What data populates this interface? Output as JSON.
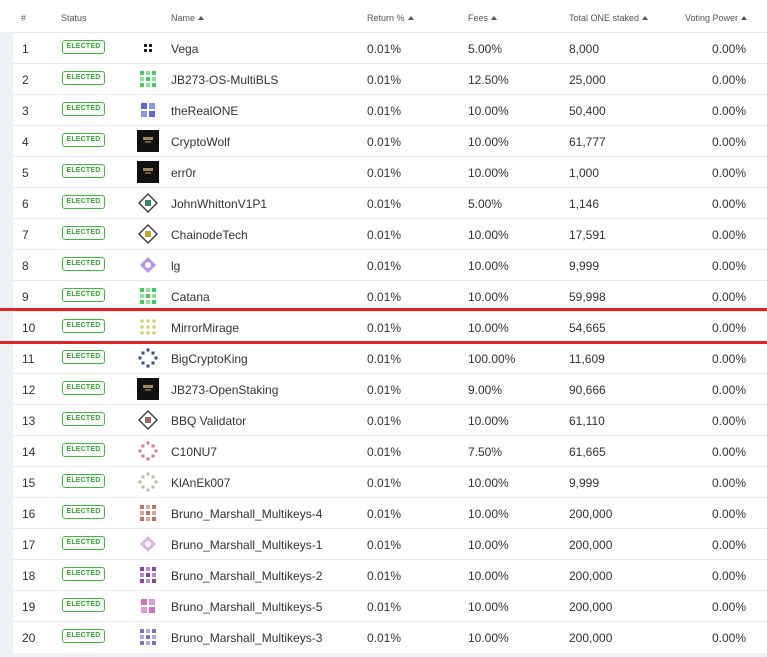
{
  "columns": {
    "rank": "#",
    "status": "Status",
    "name": "Name",
    "return": "Return %",
    "fees": "Fees",
    "staked": "Total ONE staked",
    "voting": "Voting Power"
  },
  "rows": [
    {
      "rank": "1",
      "status": "ELECTED",
      "name": "Vega",
      "return": "0.01%",
      "fees": "5.00%",
      "staked": "8,000",
      "voting": "0.00%",
      "avatar": {
        "bg": "#ffffff",
        "fg": "#222222",
        "style": "grid4"
      }
    },
    {
      "rank": "2",
      "status": "ELECTED",
      "name": "JB273-OS-MultiBLS",
      "return": "0.01%",
      "fees": "12.50%",
      "staked": "25,000",
      "voting": "0.00%",
      "avatar": {
        "bg": "#ffffff",
        "fg": "#3ccf5a",
        "style": "grid9"
      }
    },
    {
      "rank": "3",
      "status": "ELECTED",
      "name": "theRealONE",
      "return": "0.01%",
      "fees": "10.00%",
      "staked": "50,400",
      "voting": "0.00%",
      "avatar": {
        "bg": "#ffffff",
        "fg": "#5a6ad8",
        "style": "quad"
      }
    },
    {
      "rank": "4",
      "status": "ELECTED",
      "name": "CryptoWolf",
      "return": "0.01%",
      "fees": "10.00%",
      "staked": "61,777",
      "voting": "0.00%",
      "avatar": {
        "bg": "#111111",
        "fg": "#c8a868",
        "style": "photo"
      }
    },
    {
      "rank": "5",
      "status": "ELECTED",
      "name": "err0r",
      "return": "0.01%",
      "fees": "10.00%",
      "staked": "1,000",
      "voting": "0.00%",
      "avatar": {
        "bg": "#111111",
        "fg": "#c8a868",
        "style": "photo"
      }
    },
    {
      "rank": "6",
      "status": "ELECTED",
      "name": "JohnWhittonV1P1",
      "return": "0.01%",
      "fees": "5.00%",
      "staked": "1,146",
      "voting": "0.00%",
      "avatar": {
        "bg": "#ffffff",
        "fg": "#2c8c6c",
        "style": "diamond"
      }
    },
    {
      "rank": "7",
      "status": "ELECTED",
      "name": "ChainodeTech",
      "return": "0.01%",
      "fees": "10.00%",
      "staked": "17,591",
      "voting": "0.00%",
      "avatar": {
        "bg": "#ffffff",
        "fg": "#c8a030",
        "style": "diamond"
      }
    },
    {
      "rank": "8",
      "status": "ELECTED",
      "name": "lg",
      "return": "0.01%",
      "fees": "10.00%",
      "staked": "9,999",
      "voting": "0.00%",
      "avatar": {
        "bg": "#ffffff",
        "fg": "#a878d8",
        "style": "burst"
      }
    },
    {
      "rank": "9",
      "status": "ELECTED",
      "name": "Catana",
      "return": "0.01%",
      "fees": "10.00%",
      "staked": "59,998",
      "voting": "0.00%",
      "avatar": {
        "bg": "#ffffff",
        "fg": "#3ccf5a",
        "style": "grid9"
      }
    },
    {
      "rank": "10",
      "status": "ELECTED",
      "name": "MirrorMirage",
      "return": "0.01%",
      "fees": "10.00%",
      "staked": "54,665",
      "voting": "0.00%",
      "avatar": {
        "bg": "#ffffff",
        "fg": "#cfd36a",
        "style": "dots"
      }
    },
    {
      "rank": "11",
      "status": "ELECTED",
      "name": "BigCryptoKing",
      "return": "0.01%",
      "fees": "100.00%",
      "staked": "11,609",
      "voting": "0.00%",
      "avatar": {
        "bg": "#ffffff",
        "fg": "#3a4a8a",
        "style": "ring"
      }
    },
    {
      "rank": "12",
      "status": "ELECTED",
      "name": "JB273-OpenStaking",
      "return": "0.01%",
      "fees": "9.00%",
      "staked": "90,666",
      "voting": "0.00%",
      "avatar": {
        "bg": "#111111",
        "fg": "#c8a868",
        "style": "photo"
      }
    },
    {
      "rank": "13",
      "status": "ELECTED",
      "name": "BBQ Validator",
      "return": "0.01%",
      "fees": "10.00%",
      "staked": "61,110",
      "voting": "0.00%",
      "avatar": {
        "bg": "#ffffff",
        "fg": "#a0685a",
        "style": "diamond"
      }
    },
    {
      "rank": "14",
      "status": "ELECTED",
      "name": "C10NU7",
      "return": "0.01%",
      "fees": "7.50%",
      "staked": "61,665",
      "voting": "0.00%",
      "avatar": {
        "bg": "#ffffff",
        "fg": "#d87890",
        "style": "ring"
      }
    },
    {
      "rank": "15",
      "status": "ELECTED",
      "name": "KlAnEk007",
      "return": "0.01%",
      "fees": "10.00%",
      "staked": "9,999",
      "voting": "0.00%",
      "avatar": {
        "bg": "#ffffff",
        "fg": "#b8b8a0",
        "style": "ring"
      }
    },
    {
      "rank": "16",
      "status": "ELECTED",
      "name": "Bruno_Marshall_Multikeys-4",
      "return": "0.01%",
      "fees": "10.00%",
      "staked": "200,000",
      "voting": "0.00%",
      "avatar": {
        "bg": "#ffffff",
        "fg": "#c87060",
        "style": "grid9"
      }
    },
    {
      "rank": "17",
      "status": "ELECTED",
      "name": "Bruno_Marshall_Multikeys-1",
      "return": "0.01%",
      "fees": "10.00%",
      "staked": "200,000",
      "voting": "0.00%",
      "avatar": {
        "bg": "#ffffff",
        "fg": "#d8a0d8",
        "style": "burst"
      }
    },
    {
      "rank": "18",
      "status": "ELECTED",
      "name": "Bruno_Marshall_Multikeys-2",
      "return": "0.01%",
      "fees": "10.00%",
      "staked": "200,000",
      "voting": "0.00%",
      "avatar": {
        "bg": "#ffffff",
        "fg": "#9040b0",
        "style": "grid9"
      }
    },
    {
      "rank": "19",
      "status": "ELECTED",
      "name": "Bruno_Marshall_Multikeys-5",
      "return": "0.01%",
      "fees": "10.00%",
      "staked": "200,000",
      "voting": "0.00%",
      "avatar": {
        "bg": "#ffffff",
        "fg": "#d070c8",
        "style": "quad"
      }
    },
    {
      "rank": "20",
      "status": "ELECTED",
      "name": "Bruno_Marshall_Multikeys-3",
      "return": "0.01%",
      "fees": "10.00%",
      "staked": "200,000",
      "voting": "0.00%",
      "avatar": {
        "bg": "#ffffff",
        "fg": "#7a70d8",
        "style": "grid9"
      }
    }
  ],
  "highlight_row": 10,
  "colors": {
    "elected_badge": "#3cbc3c",
    "highlight_line": "#e0222a",
    "row_border": "#e7eaee"
  }
}
